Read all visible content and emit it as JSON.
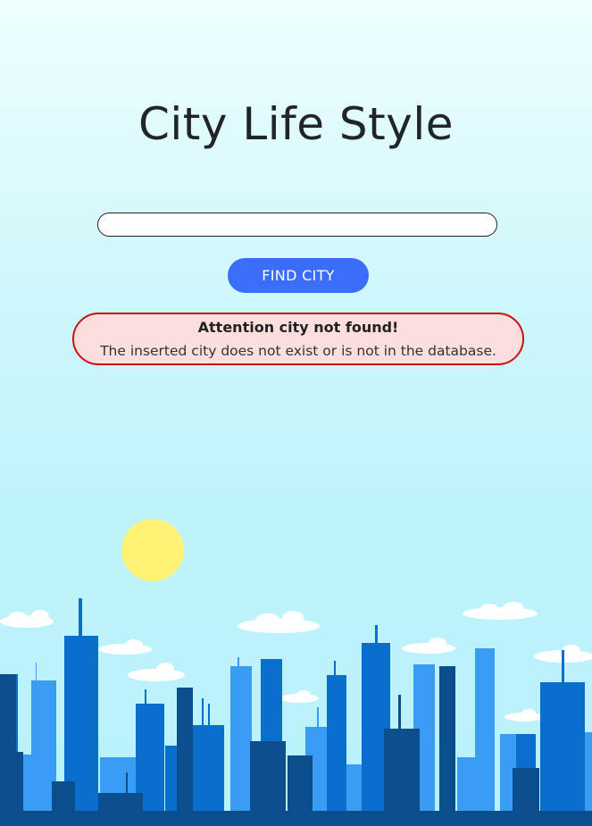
{
  "page": {
    "title": "City Life Style"
  },
  "search": {
    "value": "",
    "placeholder": ""
  },
  "button": {
    "label": "FIND CITY"
  },
  "alert": {
    "title": "Attention city not found!",
    "message": "The inserted city does not exist or is not in the database.",
    "border_color": "#cc1111",
    "background_color": "#fddede"
  },
  "colors": {
    "button": "#3a6efa",
    "sky_top": "#effefe",
    "sky_bottom": "#b9f2fb",
    "sun": "#fff275",
    "building_dark": "#0b4e8c",
    "building_mid": "#0a6fcc",
    "building_light": "#3a9cf5"
  },
  "illustration": {
    "icon": "city-skyline-illustration"
  }
}
